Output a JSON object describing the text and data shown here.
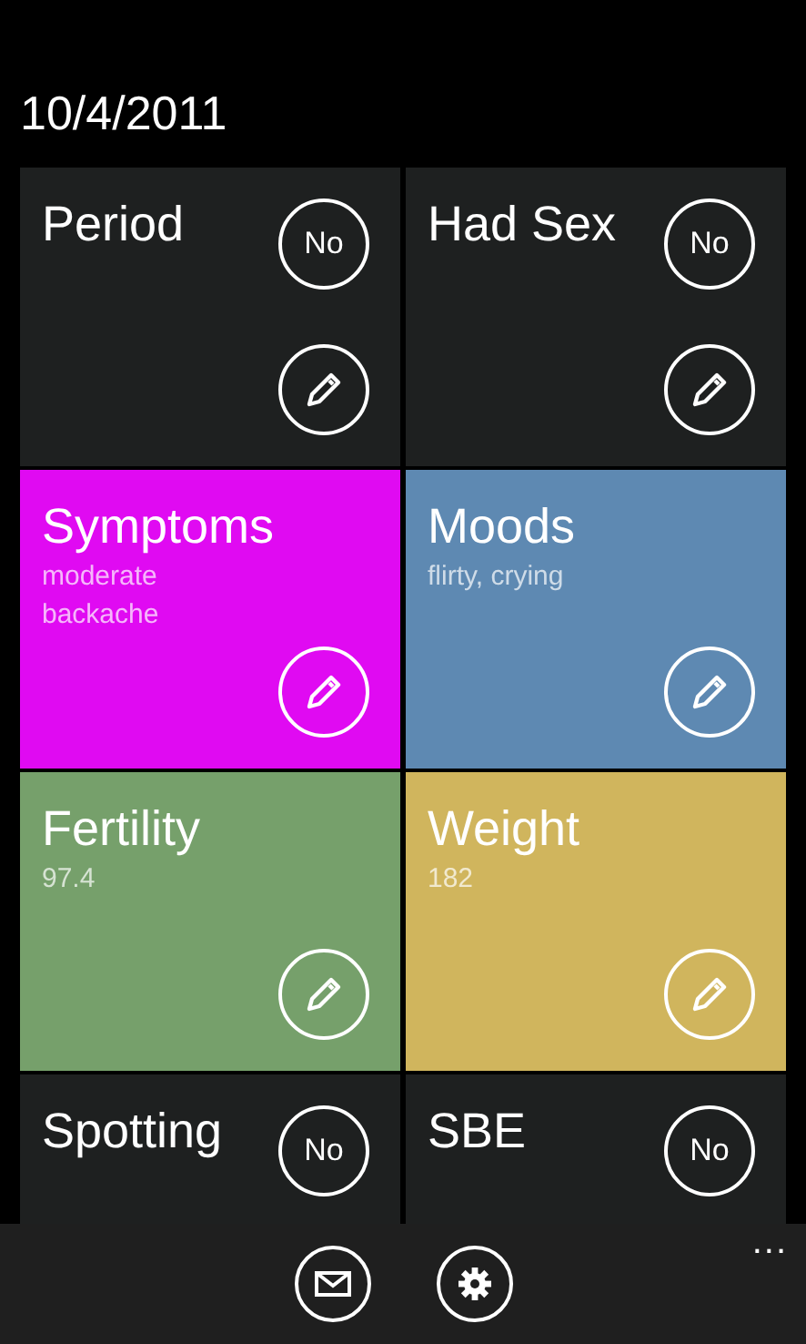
{
  "date": "10/4/2011",
  "tiles": [
    {
      "title": "Period",
      "color": "#1e2020",
      "badge": "No",
      "edit": true
    },
    {
      "title": "Had Sex",
      "color": "#1e2020",
      "badge": "No",
      "edit": true
    },
    {
      "title": "Symptoms",
      "details": [
        "moderate",
        "backache"
      ],
      "color": "#e00af2",
      "edit": true
    },
    {
      "title": "Moods",
      "details": [
        "flirty, crying"
      ],
      "color": "#5e89b2",
      "edit": true
    },
    {
      "title": "Fertility",
      "details": [
        "97.4"
      ],
      "color": "#76a06b",
      "edit": true
    },
    {
      "title": "Weight",
      "details": [
        "182"
      ],
      "color": "#d0b55d",
      "edit": true
    },
    {
      "title": "Spotting",
      "color": "#1e2020",
      "badge": "No",
      "edit": false
    },
    {
      "title": "SBE",
      "color": "#1e2020",
      "badge": "No",
      "edit": false
    }
  ],
  "app_bar": {
    "more": "..."
  }
}
